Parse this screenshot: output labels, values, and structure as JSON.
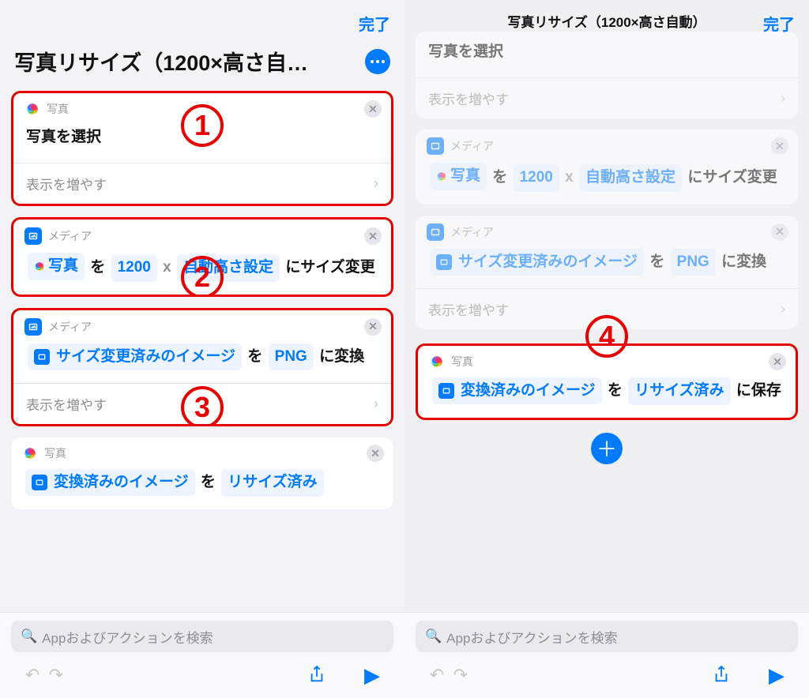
{
  "left": {
    "done": "完了",
    "title": "写真リサイズ（1200×高さ自…",
    "actions": [
      {
        "app_label": "写真",
        "body_text": "写真を選択",
        "expand": "表示を増やす",
        "annot": "1"
      },
      {
        "app_label": "メディア",
        "line_parts": {
          "token1": "写真",
          "w1": "を",
          "token2": "1200",
          "x": "x",
          "token3": "自動高さ設定",
          "w2": "にサイズ変更"
        },
        "annot": "2"
      },
      {
        "app_label": "メディア",
        "line_parts": {
          "token1": "サイズ変更済みのイメージ",
          "w1": "を",
          "token2": "PNG",
          "w2": "に変換"
        },
        "expand": "表示を増やす",
        "annot": "3"
      },
      {
        "app_label": "写真",
        "line_parts": {
          "token1": "変換済みのイメージ",
          "w1": "を",
          "token2": "リサイズ済み"
        }
      }
    ],
    "search_placeholder": "Appおよびアクションを検索"
  },
  "right": {
    "done": "完了",
    "header_title": "写真リサイズ（1200×高さ自動）",
    "dimmed_actions": [
      {
        "body_text": "写真を選択",
        "expand": "表示を増やす"
      },
      {
        "app_label": "メディア",
        "line_parts": {
          "token1": "写真",
          "w1": "を",
          "token2": "1200",
          "x": "x",
          "token3": "自動高さ設定",
          "w2": "にサイズ変更"
        }
      },
      {
        "app_label": "メディア",
        "line_parts": {
          "token1": "サイズ変更済みのイメージ",
          "w1": "を",
          "token2": "PNG",
          "w2": "に変換"
        },
        "expand": "表示を増やす"
      }
    ],
    "focus_action": {
      "app_label": "写真",
      "line_parts": {
        "token1": "変換済みのイメージ",
        "w1": "を",
        "token2": "リサイズ済み",
        "w2": "に保存"
      },
      "annot": "4"
    },
    "search_placeholder": "Appおよびアクションを検索"
  },
  "petal_colors": [
    "#ff3b30",
    "#ff9500",
    "#ffcc00",
    "#34c759",
    "#5ac8fa",
    "#007aff",
    "#af52de",
    "#ff2d55"
  ]
}
